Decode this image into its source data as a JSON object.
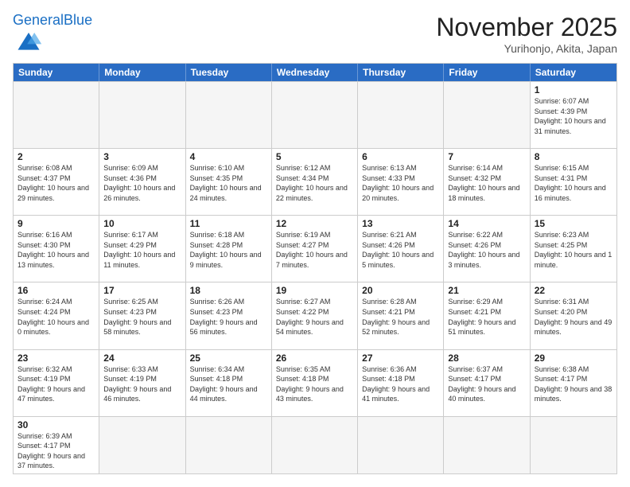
{
  "header": {
    "logo_general": "General",
    "logo_blue": "Blue",
    "month_title": "November 2025",
    "location": "Yurihonjo, Akita, Japan"
  },
  "weekdays": [
    "Sunday",
    "Monday",
    "Tuesday",
    "Wednesday",
    "Thursday",
    "Friday",
    "Saturday"
  ],
  "rows": [
    {
      "cells": [
        {
          "day": "",
          "info": "",
          "empty": true
        },
        {
          "day": "",
          "info": "",
          "empty": true
        },
        {
          "day": "",
          "info": "",
          "empty": true
        },
        {
          "day": "",
          "info": "",
          "empty": true
        },
        {
          "day": "",
          "info": "",
          "empty": true
        },
        {
          "day": "",
          "info": "",
          "empty": true
        },
        {
          "day": "1",
          "info": "Sunrise: 6:07 AM\nSunset: 4:39 PM\nDaylight: 10 hours\nand 31 minutes.",
          "empty": false
        }
      ]
    },
    {
      "cells": [
        {
          "day": "2",
          "info": "Sunrise: 6:08 AM\nSunset: 4:37 PM\nDaylight: 10 hours\nand 29 minutes.",
          "empty": false
        },
        {
          "day": "3",
          "info": "Sunrise: 6:09 AM\nSunset: 4:36 PM\nDaylight: 10 hours\nand 26 minutes.",
          "empty": false
        },
        {
          "day": "4",
          "info": "Sunrise: 6:10 AM\nSunset: 4:35 PM\nDaylight: 10 hours\nand 24 minutes.",
          "empty": false
        },
        {
          "day": "5",
          "info": "Sunrise: 6:12 AM\nSunset: 4:34 PM\nDaylight: 10 hours\nand 22 minutes.",
          "empty": false
        },
        {
          "day": "6",
          "info": "Sunrise: 6:13 AM\nSunset: 4:33 PM\nDaylight: 10 hours\nand 20 minutes.",
          "empty": false
        },
        {
          "day": "7",
          "info": "Sunrise: 6:14 AM\nSunset: 4:32 PM\nDaylight: 10 hours\nand 18 minutes.",
          "empty": false
        },
        {
          "day": "8",
          "info": "Sunrise: 6:15 AM\nSunset: 4:31 PM\nDaylight: 10 hours\nand 16 minutes.",
          "empty": false
        }
      ]
    },
    {
      "cells": [
        {
          "day": "9",
          "info": "Sunrise: 6:16 AM\nSunset: 4:30 PM\nDaylight: 10 hours\nand 13 minutes.",
          "empty": false
        },
        {
          "day": "10",
          "info": "Sunrise: 6:17 AM\nSunset: 4:29 PM\nDaylight: 10 hours\nand 11 minutes.",
          "empty": false
        },
        {
          "day": "11",
          "info": "Sunrise: 6:18 AM\nSunset: 4:28 PM\nDaylight: 10 hours\nand 9 minutes.",
          "empty": false
        },
        {
          "day": "12",
          "info": "Sunrise: 6:19 AM\nSunset: 4:27 PM\nDaylight: 10 hours\nand 7 minutes.",
          "empty": false
        },
        {
          "day": "13",
          "info": "Sunrise: 6:21 AM\nSunset: 4:26 PM\nDaylight: 10 hours\nand 5 minutes.",
          "empty": false
        },
        {
          "day": "14",
          "info": "Sunrise: 6:22 AM\nSunset: 4:26 PM\nDaylight: 10 hours\nand 3 minutes.",
          "empty": false
        },
        {
          "day": "15",
          "info": "Sunrise: 6:23 AM\nSunset: 4:25 PM\nDaylight: 10 hours\nand 1 minute.",
          "empty": false
        }
      ]
    },
    {
      "cells": [
        {
          "day": "16",
          "info": "Sunrise: 6:24 AM\nSunset: 4:24 PM\nDaylight: 10 hours\nand 0 minutes.",
          "empty": false
        },
        {
          "day": "17",
          "info": "Sunrise: 6:25 AM\nSunset: 4:23 PM\nDaylight: 9 hours\nand 58 minutes.",
          "empty": false
        },
        {
          "day": "18",
          "info": "Sunrise: 6:26 AM\nSunset: 4:23 PM\nDaylight: 9 hours\nand 56 minutes.",
          "empty": false
        },
        {
          "day": "19",
          "info": "Sunrise: 6:27 AM\nSunset: 4:22 PM\nDaylight: 9 hours\nand 54 minutes.",
          "empty": false
        },
        {
          "day": "20",
          "info": "Sunrise: 6:28 AM\nSunset: 4:21 PM\nDaylight: 9 hours\nand 52 minutes.",
          "empty": false
        },
        {
          "day": "21",
          "info": "Sunrise: 6:29 AM\nSunset: 4:21 PM\nDaylight: 9 hours\nand 51 minutes.",
          "empty": false
        },
        {
          "day": "22",
          "info": "Sunrise: 6:31 AM\nSunset: 4:20 PM\nDaylight: 9 hours\nand 49 minutes.",
          "empty": false
        }
      ]
    },
    {
      "cells": [
        {
          "day": "23",
          "info": "Sunrise: 6:32 AM\nSunset: 4:19 PM\nDaylight: 9 hours\nand 47 minutes.",
          "empty": false
        },
        {
          "day": "24",
          "info": "Sunrise: 6:33 AM\nSunset: 4:19 PM\nDaylight: 9 hours\nand 46 minutes.",
          "empty": false
        },
        {
          "day": "25",
          "info": "Sunrise: 6:34 AM\nSunset: 4:18 PM\nDaylight: 9 hours\nand 44 minutes.",
          "empty": false
        },
        {
          "day": "26",
          "info": "Sunrise: 6:35 AM\nSunset: 4:18 PM\nDaylight: 9 hours\nand 43 minutes.",
          "empty": false
        },
        {
          "day": "27",
          "info": "Sunrise: 6:36 AM\nSunset: 4:18 PM\nDaylight: 9 hours\nand 41 minutes.",
          "empty": false
        },
        {
          "day": "28",
          "info": "Sunrise: 6:37 AM\nSunset: 4:17 PM\nDaylight: 9 hours\nand 40 minutes.",
          "empty": false
        },
        {
          "day": "29",
          "info": "Sunrise: 6:38 AM\nSunset: 4:17 PM\nDaylight: 9 hours\nand 38 minutes.",
          "empty": false
        }
      ]
    },
    {
      "cells": [
        {
          "day": "30",
          "info": "Sunrise: 6:39 AM\nSunset: 4:17 PM\nDaylight: 9 hours\nand 37 minutes.",
          "empty": false
        },
        {
          "day": "",
          "info": "",
          "empty": true
        },
        {
          "day": "",
          "info": "",
          "empty": true
        },
        {
          "day": "",
          "info": "",
          "empty": true
        },
        {
          "day": "",
          "info": "",
          "empty": true
        },
        {
          "day": "",
          "info": "",
          "empty": true
        },
        {
          "day": "",
          "info": "",
          "empty": true
        }
      ]
    }
  ]
}
